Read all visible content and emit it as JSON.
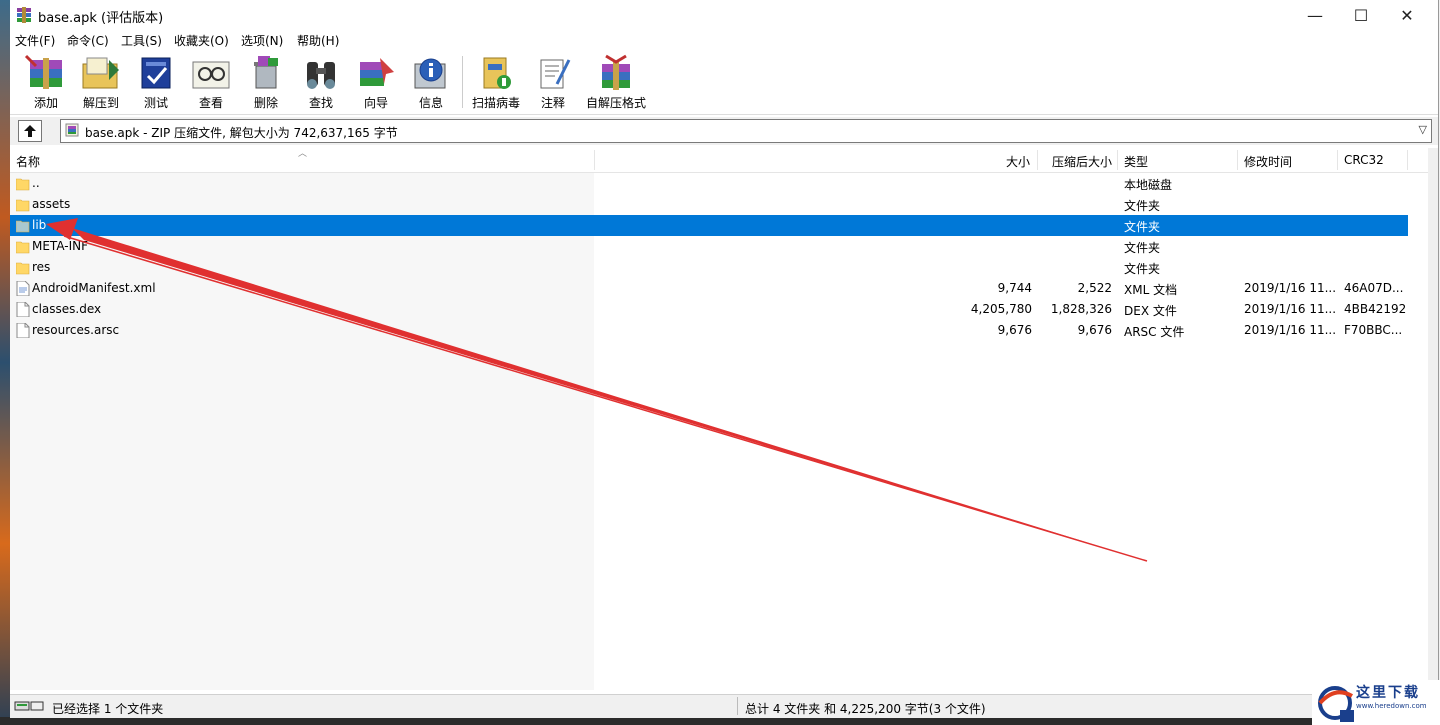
{
  "window": {
    "title": "base.apk (评估版本)",
    "controls": {
      "minimize": "—",
      "maximize": "☐",
      "close": "✕"
    }
  },
  "menu": [
    "文件(F)",
    "命令(C)",
    "工具(S)",
    "收藏夹(O)",
    "选项(N)",
    "帮助(H)"
  ],
  "toolbar": [
    {
      "label": "添加",
      "icon": "add-archive-icon"
    },
    {
      "label": "解压到",
      "icon": "extract-to-icon"
    },
    {
      "label": "测试",
      "icon": "test-icon"
    },
    {
      "label": "查看",
      "icon": "view-icon"
    },
    {
      "label": "删除",
      "icon": "delete-icon"
    },
    {
      "label": "查找",
      "icon": "find-icon"
    },
    {
      "label": "向导",
      "icon": "wizard-icon"
    },
    {
      "label": "信息",
      "icon": "info-icon"
    },
    {
      "label": "扫描病毒",
      "icon": "scan-virus-icon"
    },
    {
      "label": "注释",
      "icon": "comment-icon"
    },
    {
      "label": "自解压格式",
      "icon": "sfx-icon"
    }
  ],
  "address": {
    "text": "base.apk - ZIP 压缩文件, 解包大小为 742,637,165 字节"
  },
  "columns": {
    "name": "名称",
    "size": "大小",
    "packed": "压缩后大小",
    "type": "类型",
    "modified": "修改时间",
    "crc": "CRC32"
  },
  "rows": [
    {
      "name": "..",
      "size": "",
      "packed": "",
      "type": "本地磁盘",
      "modified": "",
      "crc": "",
      "kind": "folder"
    },
    {
      "name": "assets",
      "size": "",
      "packed": "",
      "type": "文件夹",
      "modified": "",
      "crc": "",
      "kind": "folder"
    },
    {
      "name": "lib",
      "size": "",
      "packed": "",
      "type": "文件夹",
      "modified": "",
      "crc": "",
      "kind": "folder",
      "selected": true
    },
    {
      "name": "META-INF",
      "size": "",
      "packed": "",
      "type": "文件夹",
      "modified": "",
      "crc": "",
      "kind": "folder"
    },
    {
      "name": "res",
      "size": "",
      "packed": "",
      "type": "文件夹",
      "modified": "",
      "crc": "",
      "kind": "folder"
    },
    {
      "name": "AndroidManifest.xml",
      "size": "9,744",
      "packed": "2,522",
      "type": "XML 文档",
      "modified": "2019/1/16 11...",
      "crc": "46A07D...",
      "kind": "xml"
    },
    {
      "name": "classes.dex",
      "size": "4,205,780",
      "packed": "1,828,326",
      "type": "DEX 文件",
      "modified": "2019/1/16 11...",
      "crc": "4BB42192",
      "kind": "file"
    },
    {
      "name": "resources.arsc",
      "size": "9,676",
      "packed": "9,676",
      "type": "ARSC 文件",
      "modified": "2019/1/16 11...",
      "crc": "F70BBC...",
      "kind": "file"
    }
  ],
  "status": {
    "left": "已经选择 1 个文件夹",
    "right": "总计 4 文件夹 和 4,225,200 字节(3 个文件)"
  },
  "watermark": {
    "text": "这里下载",
    "url": "www.heredown.com"
  },
  "colors": {
    "selection": "#0078d7",
    "annotation": "#e03030"
  }
}
